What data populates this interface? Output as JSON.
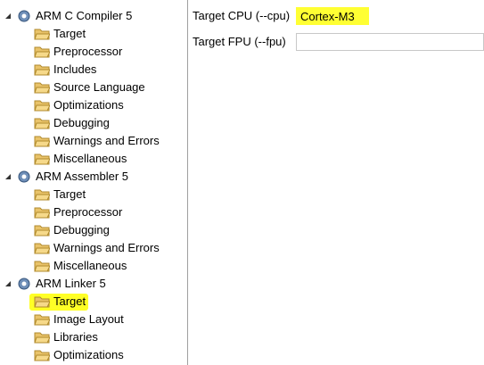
{
  "tree": {
    "groups": [
      {
        "label": "ARM C Compiler 5",
        "children": [
          "Target",
          "Preprocessor",
          "Includes",
          "Source Language",
          "Optimizations",
          "Debugging",
          "Warnings and Errors",
          "Miscellaneous"
        ]
      },
      {
        "label": "ARM Assembler 5",
        "children": [
          "Target",
          "Preprocessor",
          "Debugging",
          "Warnings and Errors",
          "Miscellaneous"
        ]
      },
      {
        "label": "ARM Linker 5",
        "children": [
          "Target",
          "Image Layout",
          "Libraries",
          "Optimizations"
        ]
      }
    ],
    "selected": "ARM Linker 5 / Target"
  },
  "panel": {
    "cpu_label": "Target CPU (--cpu)",
    "cpu_value": "Cortex-M3",
    "fpu_label": "Target FPU (--fpu)",
    "fpu_value": ""
  },
  "colors": {
    "highlight": "#ffff00",
    "divider": "#a0a0a0"
  }
}
